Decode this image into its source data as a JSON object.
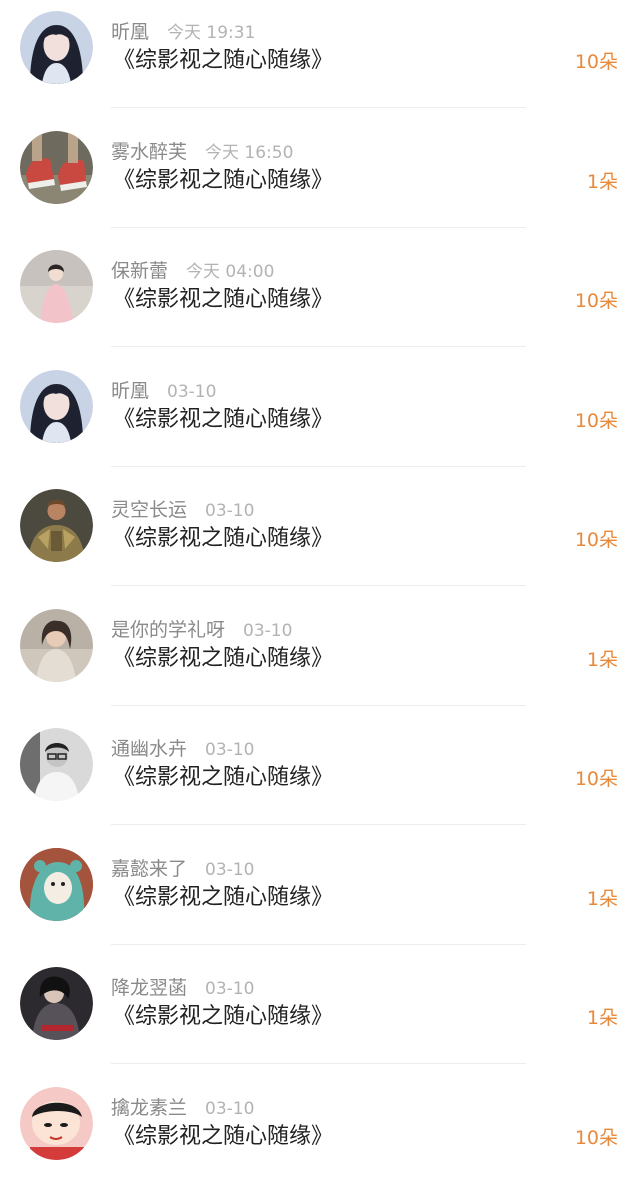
{
  "book_title": "《综影视之随心随缘》",
  "rows": [
    {
      "user": "昕凰",
      "time": "今天 19:31",
      "count": "10朵",
      "avatar": "girl-dark-hair-avatar"
    },
    {
      "user": "雾水醉芙",
      "time": "今天 16:50",
      "count": "1朵",
      "avatar": "red-sneakers-avatar"
    },
    {
      "user": "保新蕾",
      "time": "今天 04:00",
      "count": "10朵",
      "avatar": "girl-pink-dress-avatar"
    },
    {
      "user": "昕凰",
      "time": "03-10",
      "count": "10朵",
      "avatar": "girl-dark-hair-avatar"
    },
    {
      "user": "灵空长运",
      "time": "03-10",
      "count": "10朵",
      "avatar": "armored-warrior-avatar"
    },
    {
      "user": "是你的学礼呀",
      "time": "03-10",
      "count": "1朵",
      "avatar": "girl-sketch-avatar"
    },
    {
      "user": "通幽水卉",
      "time": "03-10",
      "count": "10朵",
      "avatar": "man-glasses-avatar"
    },
    {
      "user": "嘉懿来了",
      "time": "03-10",
      "count": "1朵",
      "avatar": "green-hood-cartoon-avatar"
    },
    {
      "user": "降龙翌菡",
      "time": "03-10",
      "count": "1朵",
      "avatar": "dark-portrait-avatar"
    },
    {
      "user": "擒龙素兰",
      "time": "03-10",
      "count": "10朵",
      "avatar": "cartoon-boy-avatar"
    }
  ],
  "colors": {
    "username": "#8a8a8a",
    "time": "#b3b3b3",
    "title": "#222222",
    "count": "#e88a3c",
    "divider": "#ededed"
  }
}
